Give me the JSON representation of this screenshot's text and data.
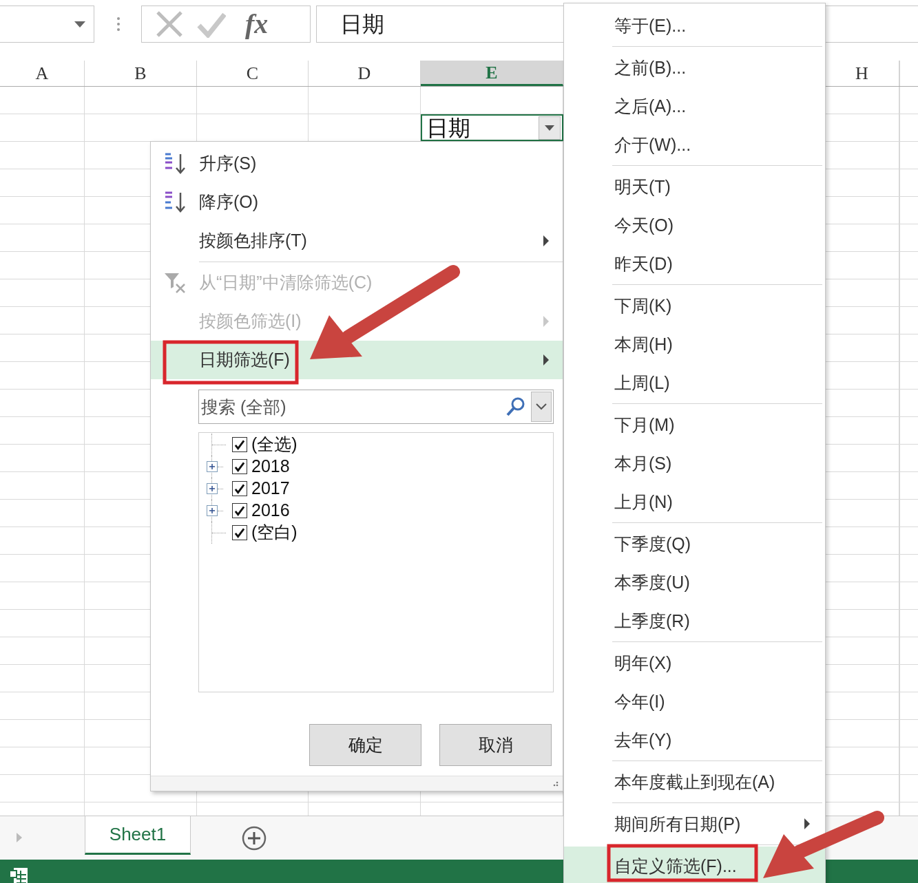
{
  "formula_bar": {
    "function_label": "fx",
    "formula": "日期"
  },
  "columns": [
    {
      "label": "A",
      "selected": false
    },
    {
      "label": "B",
      "selected": false
    },
    {
      "label": "C",
      "selected": false
    },
    {
      "label": "D",
      "selected": false
    },
    {
      "label": "E",
      "selected": true
    },
    {
      "label": "H",
      "selected": false
    }
  ],
  "active_cell": {
    "value": "日期"
  },
  "filter_menu": {
    "groups": [
      [
        {
          "label": "升序(S)",
          "kind": "sort_ascending",
          "disabled": false,
          "submenu": false,
          "selected": false
        },
        {
          "label": "降序(O)",
          "kind": "sort_descending",
          "disabled": false,
          "submenu": false,
          "selected": false
        },
        {
          "label": "按颜色排序(T)",
          "kind": "plain",
          "disabled": false,
          "submenu": true,
          "selected": false
        }
      ],
      [
        {
          "label": "从“日期”中清除筛选(C)",
          "kind": "clear_filter",
          "disabled": true,
          "submenu": false,
          "selected": false
        },
        {
          "label": "按颜色筛选(I)",
          "kind": "plain",
          "disabled": true,
          "submenu": true,
          "selected": false
        },
        {
          "label": "日期筛选(F)",
          "kind": "plain",
          "disabled": false,
          "submenu": true,
          "selected": true
        }
      ]
    ],
    "search": {
      "placeholder": "搜索 (全部)"
    },
    "tree": [
      {
        "label": "(全选)",
        "checked": true,
        "expandable": false
      },
      {
        "label": "2018",
        "checked": true,
        "expandable": true
      },
      {
        "label": "2017",
        "checked": true,
        "expandable": true
      },
      {
        "label": "2016",
        "checked": true,
        "expandable": true
      },
      {
        "label": "(空白)",
        "checked": true,
        "expandable": false
      }
    ],
    "buttons": [
      "确定",
      "取消"
    ]
  },
  "date_filter_menu": {
    "groups": [
      [
        {
          "label": "等于(E)...",
          "submenu": false,
          "selected": false
        }
      ],
      [
        {
          "label": "之前(B)...",
          "submenu": false,
          "selected": false
        },
        {
          "label": "之后(A)...",
          "submenu": false,
          "selected": false
        },
        {
          "label": "介于(W)...",
          "submenu": false,
          "selected": false
        }
      ],
      [
        {
          "label": "明天(T)",
          "submenu": false,
          "selected": false
        },
        {
          "label": "今天(O)",
          "submenu": false,
          "selected": false
        },
        {
          "label": "昨天(D)",
          "submenu": false,
          "selected": false
        }
      ],
      [
        {
          "label": "下周(K)",
          "submenu": false,
          "selected": false
        },
        {
          "label": "本周(H)",
          "submenu": false,
          "selected": false
        },
        {
          "label": "上周(L)",
          "submenu": false,
          "selected": false
        }
      ],
      [
        {
          "label": "下月(M)",
          "submenu": false,
          "selected": false
        },
        {
          "label": "本月(S)",
          "submenu": false,
          "selected": false
        },
        {
          "label": "上月(N)",
          "submenu": false,
          "selected": false
        }
      ],
      [
        {
          "label": "下季度(Q)",
          "submenu": false,
          "selected": false
        },
        {
          "label": "本季度(U)",
          "submenu": false,
          "selected": false
        },
        {
          "label": "上季度(R)",
          "submenu": false,
          "selected": false
        }
      ],
      [
        {
          "label": "明年(X)",
          "submenu": false,
          "selected": false
        },
        {
          "label": "今年(I)",
          "submenu": false,
          "selected": false
        },
        {
          "label": "去年(Y)",
          "submenu": false,
          "selected": false
        }
      ],
      [
        {
          "label": "本年度截止到现在(A)",
          "submenu": false,
          "selected": false
        }
      ],
      [
        {
          "label": "期间所有日期(P)",
          "submenu": true,
          "selected": false
        }
      ],
      [
        {
          "label": "自定义筛选(F)...",
          "submenu": false,
          "selected": true
        }
      ]
    ]
  },
  "sheet_tabs": [
    {
      "label": "Sheet1",
      "selected": true
    }
  ]
}
